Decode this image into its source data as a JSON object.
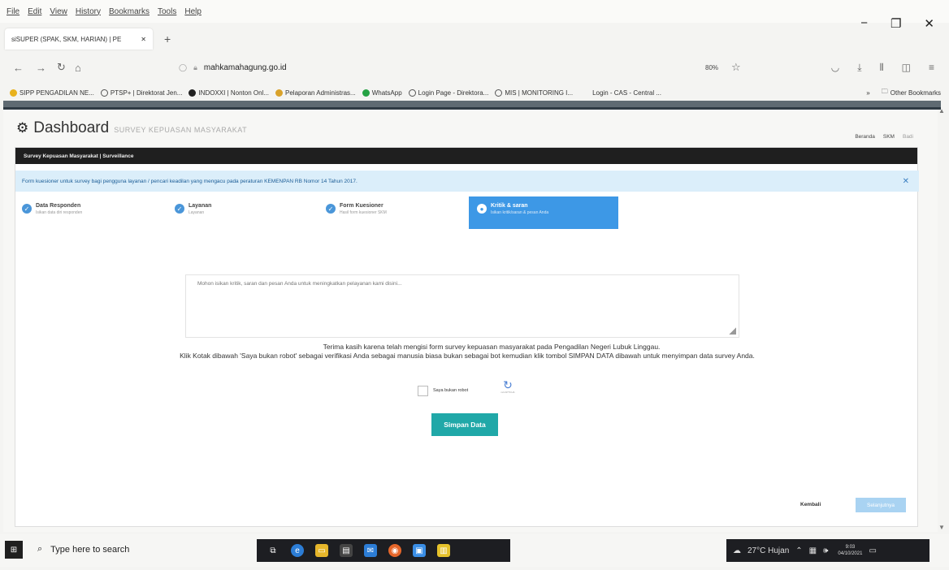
{
  "browser": {
    "menu": [
      "File",
      "Edit",
      "View",
      "History",
      "Bookmarks",
      "Tools",
      "Help"
    ],
    "tab_title": "siSUPER (SPAK, SKM, HARIAN) | PE",
    "url_host": "mahkamahagung.go.id",
    "zoom": "80%",
    "bookmarks": [
      {
        "label": "SIPP PENGADILAN NE...",
        "color": "#e8b21d"
      },
      {
        "label": "PTSP+ | Direktorat Jen...",
        "color": "#555"
      },
      {
        "label": "INDOXXI | Nonton Onl...",
        "color": "#222"
      },
      {
        "label": "Pelaporan Administras...",
        "color": "#d9a22a"
      },
      {
        "label": "WhatsApp",
        "color": "#25a244"
      },
      {
        "label": "Login Page - Direktora...",
        "color": "#555"
      },
      {
        "label": "MIS | MONITORING I...",
        "color": "#555"
      },
      {
        "label": "Login - CAS - Central ...",
        "color": "#999"
      }
    ],
    "other_bookmarks": "Other Bookmarks"
  },
  "page": {
    "title": "Dashboard",
    "subtitle": "SURVEY KEPUASAN MASYARAKAT",
    "breadcrumbs": [
      "Beranda",
      "SKM",
      "Badi"
    ],
    "panel_header": "Survey Kepuasan Masyarakat | Surveillance",
    "info": "Form kuesioner untuk survey bagi pengguna layanan / pencari keadilan yang mengacu pada peraturan KEMENPAN RB Nomor 14 Tahun 2017.",
    "steps": [
      {
        "title": "Data Responden",
        "desc": "Isikan data diri responden"
      },
      {
        "title": "Layanan",
        "desc": "Layanan"
      },
      {
        "title": "Form Kuesioner",
        "desc": "Hasil form kuesioner SKM"
      },
      {
        "title": "Kritik & saran",
        "desc": "Isikan kritik/saran & pesan Anda"
      }
    ],
    "textarea_placeholder": "Mohon isikan kritik, saran dan pesan Anda untuk meningkatkan pelayanan kami disini...",
    "thanks_line1": "Terima kasih karena telah mengisi form survey kepuasan masyarakat pada Pengadilan Negeri Lubuk Linggau.",
    "thanks_line2": "Klik Kotak dibawah 'Saya bukan robot' sebagai verifikasi Anda sebagai manusia biasa bukan sebagai bot kemudian klik tombol SIMPAN DATA dibawah untuk menyimpan data survey Anda.",
    "captcha_label": "Saya bukan robot",
    "captcha_brand": "reCAPTCHA",
    "save_button": "Simpan Data",
    "back_button": "Kembali",
    "next_button": "Selanjutnya"
  },
  "taskbar": {
    "search_placeholder": "Type here to search",
    "weather": "27°C Hujan",
    "time": "9:03",
    "date": "04/10/2021"
  },
  "colors": {
    "accent": "#3d98e6",
    "save": "#20a8a8",
    "info_bg": "#dbeefa"
  }
}
